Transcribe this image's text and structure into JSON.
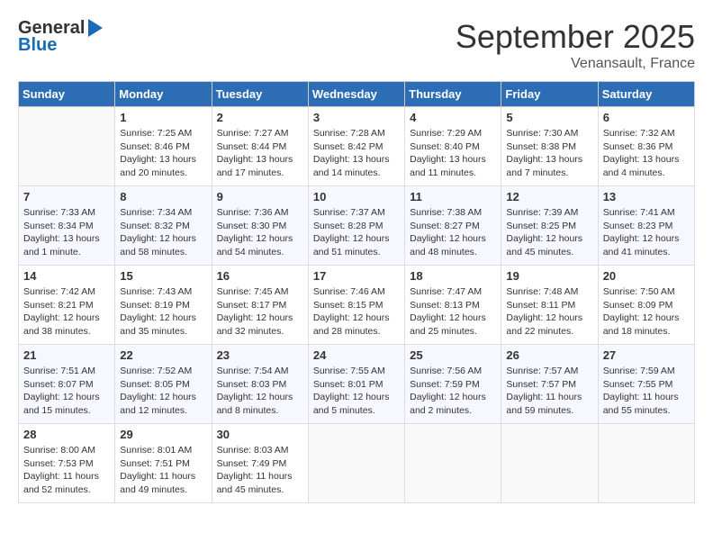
{
  "header": {
    "logo_general": "General",
    "logo_blue": "Blue",
    "month_title": "September 2025",
    "location": "Venansault, France"
  },
  "weekdays": [
    "Sunday",
    "Monday",
    "Tuesday",
    "Wednesday",
    "Thursday",
    "Friday",
    "Saturday"
  ],
  "weeks": [
    [
      {
        "day": "",
        "sunrise": "",
        "sunset": "",
        "daylight": ""
      },
      {
        "day": "1",
        "sunrise": "Sunrise: 7:25 AM",
        "sunset": "Sunset: 8:46 PM",
        "daylight": "Daylight: 13 hours and 20 minutes."
      },
      {
        "day": "2",
        "sunrise": "Sunrise: 7:27 AM",
        "sunset": "Sunset: 8:44 PM",
        "daylight": "Daylight: 13 hours and 17 minutes."
      },
      {
        "day": "3",
        "sunrise": "Sunrise: 7:28 AM",
        "sunset": "Sunset: 8:42 PM",
        "daylight": "Daylight: 13 hours and 14 minutes."
      },
      {
        "day": "4",
        "sunrise": "Sunrise: 7:29 AM",
        "sunset": "Sunset: 8:40 PM",
        "daylight": "Daylight: 13 hours and 11 minutes."
      },
      {
        "day": "5",
        "sunrise": "Sunrise: 7:30 AM",
        "sunset": "Sunset: 8:38 PM",
        "daylight": "Daylight: 13 hours and 7 minutes."
      },
      {
        "day": "6",
        "sunrise": "Sunrise: 7:32 AM",
        "sunset": "Sunset: 8:36 PM",
        "daylight": "Daylight: 13 hours and 4 minutes."
      }
    ],
    [
      {
        "day": "7",
        "sunrise": "Sunrise: 7:33 AM",
        "sunset": "Sunset: 8:34 PM",
        "daylight": "Daylight: 13 hours and 1 minute."
      },
      {
        "day": "8",
        "sunrise": "Sunrise: 7:34 AM",
        "sunset": "Sunset: 8:32 PM",
        "daylight": "Daylight: 12 hours and 58 minutes."
      },
      {
        "day": "9",
        "sunrise": "Sunrise: 7:36 AM",
        "sunset": "Sunset: 8:30 PM",
        "daylight": "Daylight: 12 hours and 54 minutes."
      },
      {
        "day": "10",
        "sunrise": "Sunrise: 7:37 AM",
        "sunset": "Sunset: 8:28 PM",
        "daylight": "Daylight: 12 hours and 51 minutes."
      },
      {
        "day": "11",
        "sunrise": "Sunrise: 7:38 AM",
        "sunset": "Sunset: 8:27 PM",
        "daylight": "Daylight: 12 hours and 48 minutes."
      },
      {
        "day": "12",
        "sunrise": "Sunrise: 7:39 AM",
        "sunset": "Sunset: 8:25 PM",
        "daylight": "Daylight: 12 hours and 45 minutes."
      },
      {
        "day": "13",
        "sunrise": "Sunrise: 7:41 AM",
        "sunset": "Sunset: 8:23 PM",
        "daylight": "Daylight: 12 hours and 41 minutes."
      }
    ],
    [
      {
        "day": "14",
        "sunrise": "Sunrise: 7:42 AM",
        "sunset": "Sunset: 8:21 PM",
        "daylight": "Daylight: 12 hours and 38 minutes."
      },
      {
        "day": "15",
        "sunrise": "Sunrise: 7:43 AM",
        "sunset": "Sunset: 8:19 PM",
        "daylight": "Daylight: 12 hours and 35 minutes."
      },
      {
        "day": "16",
        "sunrise": "Sunrise: 7:45 AM",
        "sunset": "Sunset: 8:17 PM",
        "daylight": "Daylight: 12 hours and 32 minutes."
      },
      {
        "day": "17",
        "sunrise": "Sunrise: 7:46 AM",
        "sunset": "Sunset: 8:15 PM",
        "daylight": "Daylight: 12 hours and 28 minutes."
      },
      {
        "day": "18",
        "sunrise": "Sunrise: 7:47 AM",
        "sunset": "Sunset: 8:13 PM",
        "daylight": "Daylight: 12 hours and 25 minutes."
      },
      {
        "day": "19",
        "sunrise": "Sunrise: 7:48 AM",
        "sunset": "Sunset: 8:11 PM",
        "daylight": "Daylight: 12 hours and 22 minutes."
      },
      {
        "day": "20",
        "sunrise": "Sunrise: 7:50 AM",
        "sunset": "Sunset: 8:09 PM",
        "daylight": "Daylight: 12 hours and 18 minutes."
      }
    ],
    [
      {
        "day": "21",
        "sunrise": "Sunrise: 7:51 AM",
        "sunset": "Sunset: 8:07 PM",
        "daylight": "Daylight: 12 hours and 15 minutes."
      },
      {
        "day": "22",
        "sunrise": "Sunrise: 7:52 AM",
        "sunset": "Sunset: 8:05 PM",
        "daylight": "Daylight: 12 hours and 12 minutes."
      },
      {
        "day": "23",
        "sunrise": "Sunrise: 7:54 AM",
        "sunset": "Sunset: 8:03 PM",
        "daylight": "Daylight: 12 hours and 8 minutes."
      },
      {
        "day": "24",
        "sunrise": "Sunrise: 7:55 AM",
        "sunset": "Sunset: 8:01 PM",
        "daylight": "Daylight: 12 hours and 5 minutes."
      },
      {
        "day": "25",
        "sunrise": "Sunrise: 7:56 AM",
        "sunset": "Sunset: 7:59 PM",
        "daylight": "Daylight: 12 hours and 2 minutes."
      },
      {
        "day": "26",
        "sunrise": "Sunrise: 7:57 AM",
        "sunset": "Sunset: 7:57 PM",
        "daylight": "Daylight: 11 hours and 59 minutes."
      },
      {
        "day": "27",
        "sunrise": "Sunrise: 7:59 AM",
        "sunset": "Sunset: 7:55 PM",
        "daylight": "Daylight: 11 hours and 55 minutes."
      }
    ],
    [
      {
        "day": "28",
        "sunrise": "Sunrise: 8:00 AM",
        "sunset": "Sunset: 7:53 PM",
        "daylight": "Daylight: 11 hours and 52 minutes."
      },
      {
        "day": "29",
        "sunrise": "Sunrise: 8:01 AM",
        "sunset": "Sunset: 7:51 PM",
        "daylight": "Daylight: 11 hours and 49 minutes."
      },
      {
        "day": "30",
        "sunrise": "Sunrise: 8:03 AM",
        "sunset": "Sunset: 7:49 PM",
        "daylight": "Daylight: 11 hours and 45 minutes."
      },
      {
        "day": "",
        "sunrise": "",
        "sunset": "",
        "daylight": ""
      },
      {
        "day": "",
        "sunrise": "",
        "sunset": "",
        "daylight": ""
      },
      {
        "day": "",
        "sunrise": "",
        "sunset": "",
        "daylight": ""
      },
      {
        "day": "",
        "sunrise": "",
        "sunset": "",
        "daylight": ""
      }
    ]
  ]
}
